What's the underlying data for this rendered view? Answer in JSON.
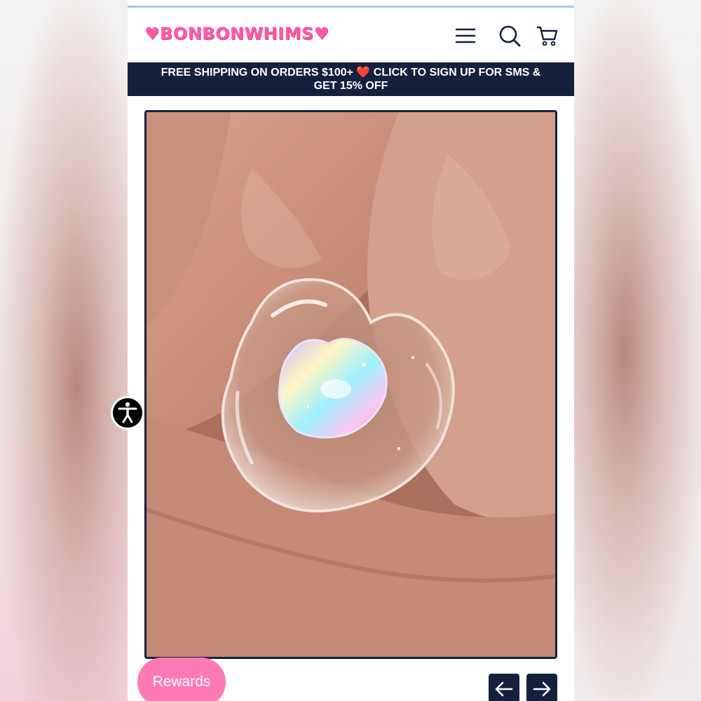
{
  "header": {
    "logo_text": "♥BONBONWHIMS♥",
    "menu_icon": "hamburger-menu-icon",
    "search_icon": "search-icon",
    "cart_icon": "cart-icon"
  },
  "banner": {
    "line1_before_heart": "FREE SHIPPING ON ORDERS $100+",
    "heart": "❤️",
    "line1_after_heart": "CLICK TO SIGN UP FOR SMS &",
    "line2": "GET 15% OFF"
  },
  "product_image": {
    "subject": "clear resin heart ring with holographic heart gem worn on finger"
  },
  "accessibility": {
    "icon": "accessibility-icon"
  },
  "rewards": {
    "label": "Rewards"
  },
  "carousel": {
    "prev_icon": "arrow-left-icon",
    "next_icon": "arrow-right-icon"
  },
  "colors": {
    "brand_pink": "#ff5aa6",
    "navy": "#14213d",
    "rewards_pink": "#ff7ab5",
    "heart_red": "#e0112b"
  }
}
